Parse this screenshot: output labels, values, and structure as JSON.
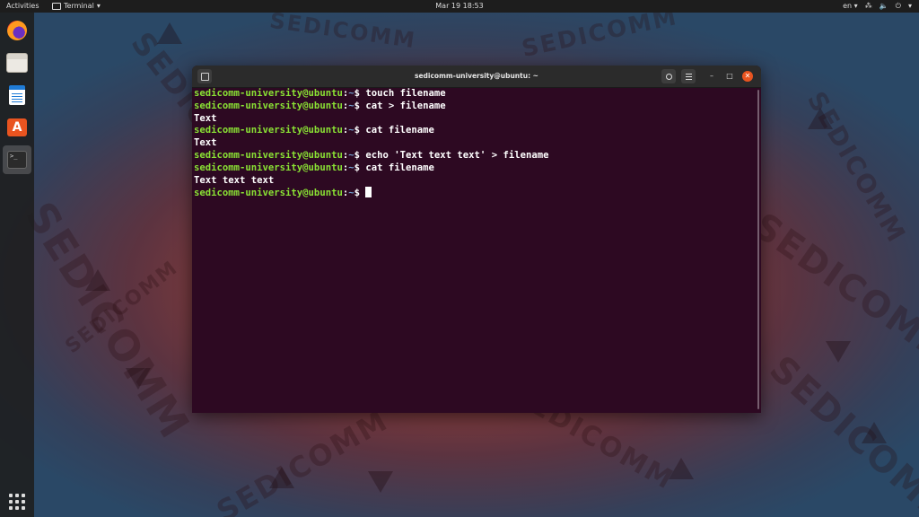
{
  "topbar": {
    "activities": "Activities",
    "app_name": "Terminal",
    "app_menu_arrow": "▾",
    "clock": "Mar 19  18:53",
    "lang": "en",
    "lang_arrow": "▾",
    "network_glyph": "⁂",
    "volume_glyph": "🔈",
    "power_glyph": "⏻",
    "tray_arrow": "▾"
  },
  "wallpaper": {
    "watermark_text": "SEDICOMM"
  },
  "dock": {
    "items": [
      {
        "name": "firefox-icon"
      },
      {
        "name": "files-icon"
      },
      {
        "name": "libreoffice-writer-icon"
      },
      {
        "name": "ubuntu-software-icon",
        "glyph": "A"
      },
      {
        "name": "terminal-icon",
        "glyph": ">_",
        "active": true
      }
    ],
    "show_apps": "show-applications-icon"
  },
  "terminal": {
    "title": "sedicomm-university@ubuntu: ~",
    "prompt_user": "sedicomm-university@ubuntu",
    "prompt_colon": ":",
    "prompt_path": "~",
    "prompt_symbol": "$",
    "lines": [
      {
        "type": "cmd",
        "text": " touch filename"
      },
      {
        "type": "cmd",
        "text": " cat > filename"
      },
      {
        "type": "out",
        "text": "Text"
      },
      {
        "type": "cmd",
        "text": " cat filename"
      },
      {
        "type": "out",
        "text": "Text"
      },
      {
        "type": "cmd",
        "text": " echo 'Text text text' > filename"
      },
      {
        "type": "cmd",
        "text": " cat filename"
      },
      {
        "type": "out",
        "text": "Text text text"
      },
      {
        "type": "cmd",
        "text": " ",
        "cursor": true
      }
    ],
    "min_glyph": "–",
    "max_glyph": "□",
    "close_glyph": "✕"
  },
  "colors": {
    "terminal_bg": "#2d0922",
    "prompt_user": "#8ae234",
    "prompt_path": "#729fcf",
    "accent": "#e95420"
  }
}
